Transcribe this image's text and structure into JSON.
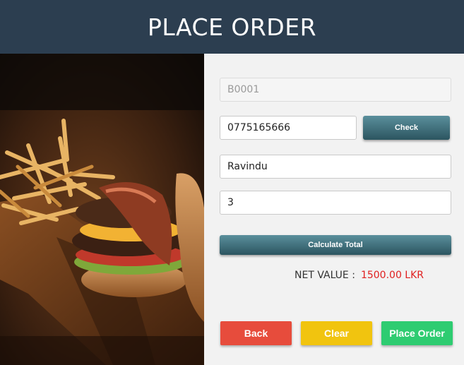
{
  "header": {
    "title": "PLACE ORDER"
  },
  "form": {
    "order_id": "B0001",
    "phone": "0775165666",
    "check_label": "Check",
    "customer_name": "Ravindu",
    "quantity": "3",
    "calculate_label": "Calculate Total",
    "net_value_label": "NET VALUE :",
    "net_value": "1500.00 LKR"
  },
  "actions": {
    "back_label": "Back",
    "clear_label": "Clear",
    "place_order_label": "Place Order"
  },
  "colors": {
    "header": "#2c3e50",
    "back": "#e74c3c",
    "clear": "#f1c40f",
    "place_order": "#2ecc71",
    "net_value": "#e02020"
  },
  "image": {
    "subject": "burger-and-fries-photo"
  }
}
